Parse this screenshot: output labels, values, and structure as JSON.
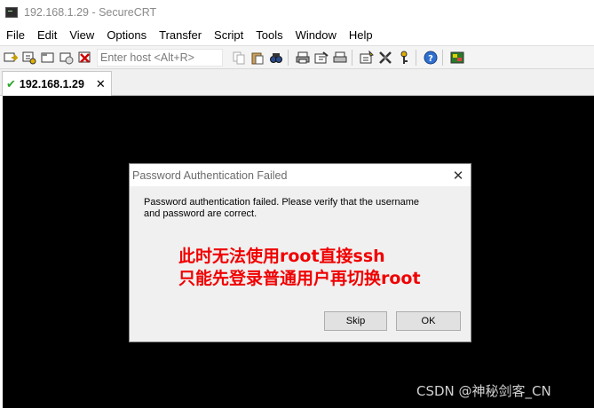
{
  "window": {
    "title": "192.168.1.29 - SecureCRT"
  },
  "menu": {
    "items": [
      "File",
      "Edit",
      "View",
      "Options",
      "Transfer",
      "Script",
      "Tools",
      "Window",
      "Help"
    ]
  },
  "toolbar": {
    "host_placeholder": "Enter host <Alt+R>"
  },
  "tabs": [
    {
      "label": "192.168.1.29",
      "status": "connected"
    }
  ],
  "dialog": {
    "title": "Password Authentication Failed",
    "message_line1": "Password authentication failed. Please verify that the username",
    "message_line2": "and password are correct.",
    "annotation_line1": "此时无法使用root直接ssh",
    "annotation_line2": "只能先登录普通用户再切换root",
    "skip_label": "Skip",
    "ok_label": "OK",
    "annotation_color": "#f00000"
  },
  "watermark": "CSDN @神秘剑客_CN"
}
